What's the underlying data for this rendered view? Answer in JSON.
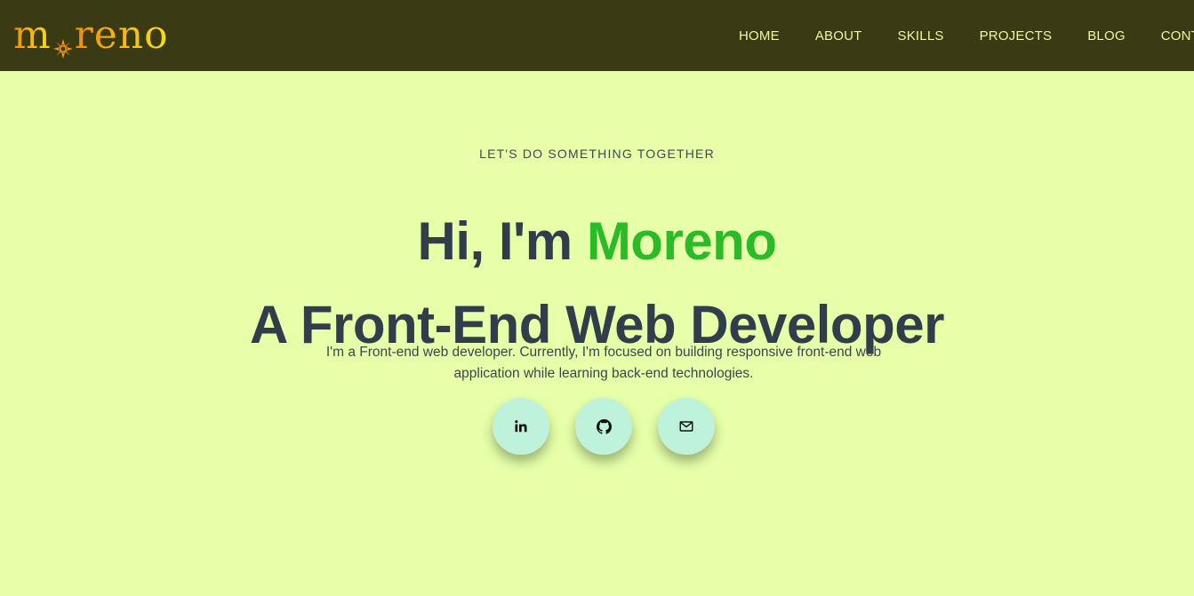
{
  "header": {
    "logo": {
      "left": "m",
      "right": "reno"
    },
    "nav": [
      "HOME",
      "ABOUT",
      "SKILLS",
      "PROJECTS",
      "BLOG",
      "CONTACT"
    ]
  },
  "hero": {
    "eyebrow": "LET'S DO SOMETHING TOGETHER",
    "greeting": "Hi, I'm ",
    "name": "Moreno",
    "role": "A Front-End Web Developer",
    "intro_line1": "I'm a Front-end web developer. Currently, I'm focused on building responsive front-end web",
    "intro_line2": "application while learning back-end technologies.",
    "socials": [
      {
        "icon": "linkedin-icon"
      },
      {
        "icon": "github-icon"
      },
      {
        "icon": "mail-icon"
      }
    ]
  },
  "colors": {
    "nav_background": "#3a3a15",
    "page_background": "#e6ffa8",
    "nav_text": "#f0f7a0",
    "heading_text": "#323d4c",
    "name_accent": "#2bbb28",
    "social_button": "#bff2da",
    "logo_gradient": [
      "#f08c0a",
      "#f5de18"
    ]
  }
}
